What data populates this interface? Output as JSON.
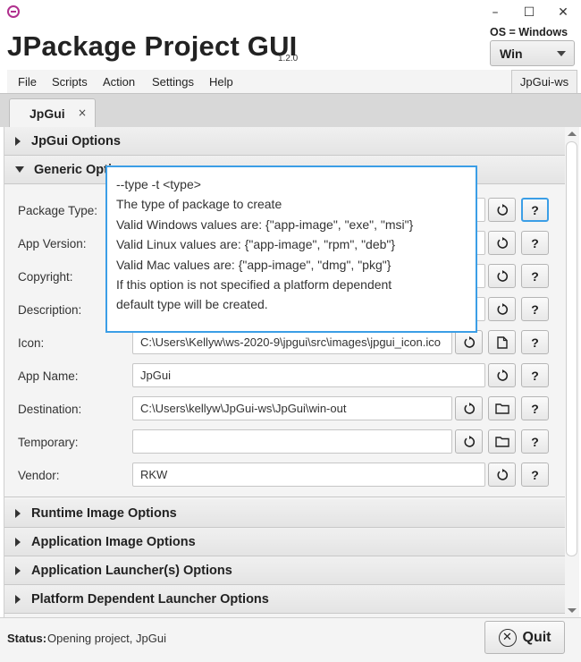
{
  "window": {
    "minimize_glyph": "–",
    "maximize_glyph": "☐",
    "close_glyph": "✕"
  },
  "header": {
    "title": "JPackage Project GUI",
    "version": "1.2.0",
    "os_label": "OS = Windows",
    "os_select_value": "Win"
  },
  "menu": {
    "items": [
      "File",
      "Scripts",
      "Action",
      "Settings",
      "Help"
    ],
    "workspace_button": "JpGui-ws"
  },
  "tab": {
    "label": "JpGui",
    "close_glyph": "×"
  },
  "sections": {
    "jpgui_options": "JpGui Options",
    "generic_options": "Generic Options",
    "runtime_image": "Runtime Image Options",
    "application_image": "Application Image Options",
    "application_launchers": "Application Launcher(s) Options",
    "platform_launcher": "Platform Dependent Launcher Options"
  },
  "fields": [
    {
      "label": "Package Type:",
      "value": ""
    },
    {
      "label": "App Version:",
      "value": ""
    },
    {
      "label": "Copyright:",
      "value": ""
    },
    {
      "label": "Description:",
      "value": ""
    },
    {
      "label": "Icon:",
      "value": "C:\\Users\\Kellyw\\ws-2020-9\\jpgui\\src\\images\\jpgui_icon.ico"
    },
    {
      "label": "App Name:",
      "value": "JpGui"
    },
    {
      "label": "Destination:",
      "value": "C:\\Users\\kellyw\\JpGui-ws\\JpGui\\win-out"
    },
    {
      "label": "Temporary:",
      "value": ""
    },
    {
      "label": "Vendor:",
      "value": "RKW"
    }
  ],
  "buttons": {
    "help": "?"
  },
  "tooltip": {
    "lines": [
      "--type -t <type>",
      "The type of package to create",
      "Valid Windows values are: {\"app-image\", \"exe\", \"msi\"}",
      "Valid Linux values are: {\"app-image\", \"rpm\", \"deb\"}",
      "Valid Mac values are: {\"app-image\", \"dmg\", \"pkg\"}",
      "If this option is not specified a platform dependent",
      "default type will be created."
    ]
  },
  "status": {
    "label": "Status:",
    "text": "Opening project, JpGui"
  },
  "quit": {
    "label": "Quit",
    "icon_glyph": "✕"
  },
  "colors": {
    "focus_accent": "#3b9ee6",
    "logo": "#b0308e"
  }
}
